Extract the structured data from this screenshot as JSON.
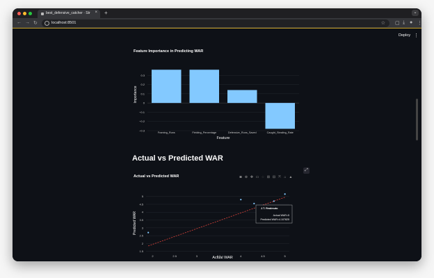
{
  "browser": {
    "tab_title": "best_defensive_catcher · Str",
    "url": "localhost:8501"
  },
  "app": {
    "deploy_label": "Deploy",
    "section_heading": "Actual vs Predicted WAR",
    "colors": {
      "bar": "#83c9ff",
      "background": "#0e1117",
      "scatter_point": "#83c9ff",
      "trend_line": "#e0443b"
    }
  },
  "chart_data": [
    {
      "type": "bar",
      "title": "Feature Importance in Predicting WAR",
      "xlabel": "Feature",
      "ylabel": "Importance",
      "categories": [
        "Framing_Runs",
        "Fielding_Percentage",
        "Defensive_Runs_Saved",
        "Caught_Stealing_Rate"
      ],
      "values": [
        0.36,
        0.36,
        0.14,
        -0.28
      ],
      "ylim": [
        -0.3,
        0.4
      ],
      "yticks": [
        "0.3",
        "0.2",
        "0.1",
        "0",
        "−0.1",
        "−0.2",
        "−0.3"
      ],
      "grid": true
    },
    {
      "type": "scatter",
      "title": "Actual vs Predicted WAR",
      "xlabel": "Actual WAR",
      "ylabel": "Predicted WAR",
      "xticks": [
        "2",
        "2.5",
        "3",
        "3.5",
        "4",
        "4.5",
        "5"
      ],
      "yticks": [
        "1.5",
        "2",
        "2.5",
        "3",
        "3.5",
        "4",
        "4.5",
        "5"
      ],
      "xlim": [
        1.85,
        5.1
      ],
      "ylim": [
        1.4,
        5.25
      ],
      "points": [
        {
          "x": 1.9,
          "y": 2.7
        },
        {
          "x": 4.0,
          "y": 4.8
        },
        {
          "x": 4.3,
          "y": 4.55
        },
        {
          "x": 4.75,
          "y": 4.7
        },
        {
          "x": 5.0,
          "y": 5.15
        },
        {
          "x": 5.0,
          "y": 3.95
        },
        {
          "x": 5.0,
          "y": 4.11
        }
      ],
      "trend_line": {
        "x": [
          1.9,
          5.0
        ],
        "y": [
          1.85,
          4.95
        ]
      },
      "tooltip": {
        "name": "J.T. Realmuto",
        "actual_line": "Actual WAR=5",
        "predicted_line": "Predicted WAR=4.107825"
      },
      "grid": true
    }
  ]
}
